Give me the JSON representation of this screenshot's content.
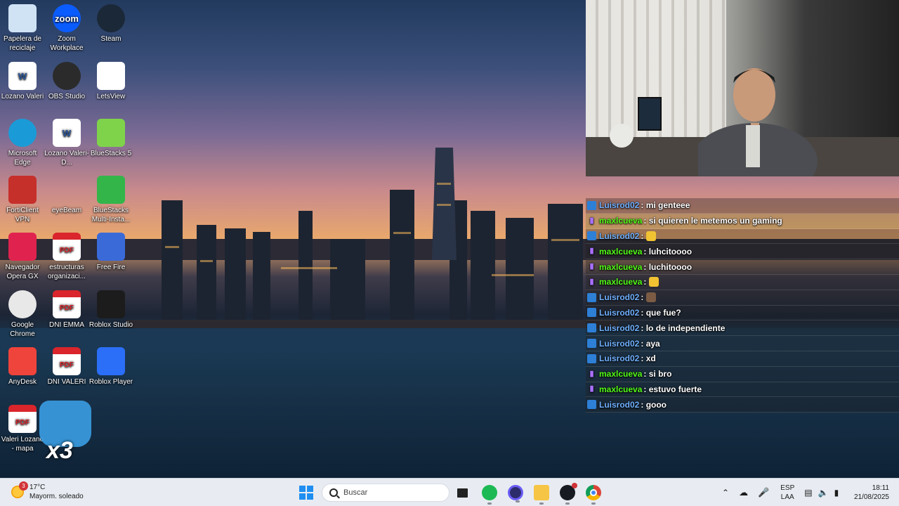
{
  "desktop": {
    "icons": [
      {
        "label": "Papelera de reciclaje",
        "icon": "recycle-bin-icon"
      },
      {
        "label": "Zoom Workplace",
        "icon": "zoom-icon",
        "glyph": "zoom"
      },
      {
        "label": "Steam",
        "icon": "steam-icon"
      },
      {
        "label": "Lozano Valeri",
        "icon": "word-doc-icon",
        "glyph": "W"
      },
      {
        "label": "OBS Studio",
        "icon": "obs-icon"
      },
      {
        "label": "LetsView",
        "icon": "letsview-icon"
      },
      {
        "label": "Microsoft Edge",
        "icon": "edge-icon"
      },
      {
        "label": "Lozano Valeri- D...",
        "icon": "word-doc-icon",
        "glyph": "W"
      },
      {
        "label": "BlueStacks 5",
        "icon": "bluestacks-icon"
      },
      {
        "label": "FortiClient VPN",
        "icon": "forticlient-icon"
      },
      {
        "label": "eyeBeam",
        "icon": "eyebeam-icon"
      },
      {
        "label": "BlueStacks Multi-Insta...",
        "icon": "bluestacks-multi-icon"
      },
      {
        "label": "Navegador Opera GX",
        "icon": "opera-gx-icon"
      },
      {
        "label": "estructuras organizaci...",
        "icon": "pdf-icon",
        "glyph": "PDF"
      },
      {
        "label": "Free Fire",
        "icon": "free-fire-icon"
      },
      {
        "label": "Google Chrome",
        "icon": "chrome-icon"
      },
      {
        "label": "DNI EMMA",
        "icon": "pdf-icon",
        "glyph": "PDF"
      },
      {
        "label": "Roblox Studio",
        "icon": "roblox-studio-icon"
      },
      {
        "label": "AnyDesk",
        "icon": "anydesk-icon"
      },
      {
        "label": "DNI VALERI",
        "icon": "pdf-icon",
        "glyph": "PDF"
      },
      {
        "label": "Roblox Player",
        "icon": "roblox-player-icon"
      },
      {
        "label": "Valeri Lozano - mapa",
        "icon": "pdf-icon",
        "glyph": "PDF"
      }
    ],
    "overlay_text": "x3"
  },
  "chat": {
    "messages": [
      {
        "user": "Luisrod02",
        "platform": "kick",
        "text": ": mi genteee"
      },
      {
        "user": "maxlcueva",
        "platform": "twitch",
        "text": ": si quieren le metemos un gaming",
        "highlight": true
      },
      {
        "user": "Luisrod02",
        "platform": "kick",
        "text": ":",
        "emoji": "hand-emoji"
      },
      {
        "user": "maxlcueva",
        "platform": "twitch",
        "text": ": luhcitoooo"
      },
      {
        "user": "maxlcueva",
        "platform": "twitch",
        "text": ": luchitoooo"
      },
      {
        "user": "maxlcueva",
        "platform": "twitch",
        "text": ":",
        "emoji": "hand-emoji"
      },
      {
        "user": "Luisrod02",
        "platform": "kick",
        "text": ":",
        "emoji": "person-emoji"
      },
      {
        "user": "Luisrod02",
        "platform": "kick",
        "text": ": que fue?"
      },
      {
        "user": "Luisrod02",
        "platform": "kick",
        "text": ": lo de independiente"
      },
      {
        "user": "Luisrod02",
        "platform": "kick",
        "text": ": aya"
      },
      {
        "user": "Luisrod02",
        "platform": "kick",
        "text": ": xd"
      },
      {
        "user": "maxlcueva",
        "platform": "twitch",
        "text": ": si bro"
      },
      {
        "user": "maxlcueva",
        "platform": "twitch",
        "text": ": estuvo fuerte"
      },
      {
        "user": "Luisrod02",
        "platform": "kick",
        "text": ": gooo"
      }
    ]
  },
  "taskbar": {
    "weather": {
      "temp": "17°C",
      "condition": "Mayorm. soleado",
      "badge": "3"
    },
    "search_placeholder": "Buscar",
    "apps": [
      "file-explorer-stack-icon",
      "spotify-icon",
      "obs-taskbar-icon",
      "folder-icon",
      "steam-taskbar-icon",
      "chrome-taskbar-icon"
    ],
    "tray": {
      "lang": "ESP",
      "layout": "LAA"
    },
    "clock": {
      "time": "18:11",
      "date": "21/08/2025"
    }
  }
}
